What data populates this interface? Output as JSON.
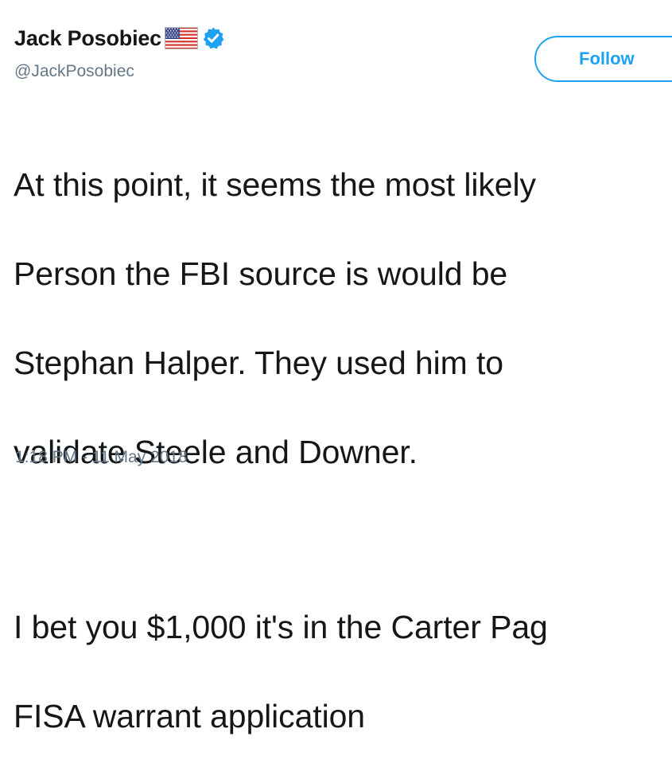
{
  "author": {
    "display_name": "Jack Posobiec",
    "handle": "@JackPosobiec",
    "flag_icon": "us-flag-icon",
    "verified_icon": "verified-badge-icon",
    "verified_color": "#1da1f2"
  },
  "follow_button": {
    "label": "Follow",
    "color": "#1da1f2"
  },
  "tweet": {
    "lines_paragraph_1": [
      "At this point, it seems the most likely",
      "Person the FBI source is would be",
      "Stephan Halper. They used him to",
      "validate Steele and Downer."
    ],
    "lines_paragraph_2": [
      "I bet you $1,000 it's in the Carter Pag",
      "FISA warrant application"
    ],
    "timestamp": "1:18 PM - 11 May 2018"
  },
  "colors": {
    "text": "#14171a",
    "secondary_text": "#657786",
    "accent": "#1da1f2"
  }
}
